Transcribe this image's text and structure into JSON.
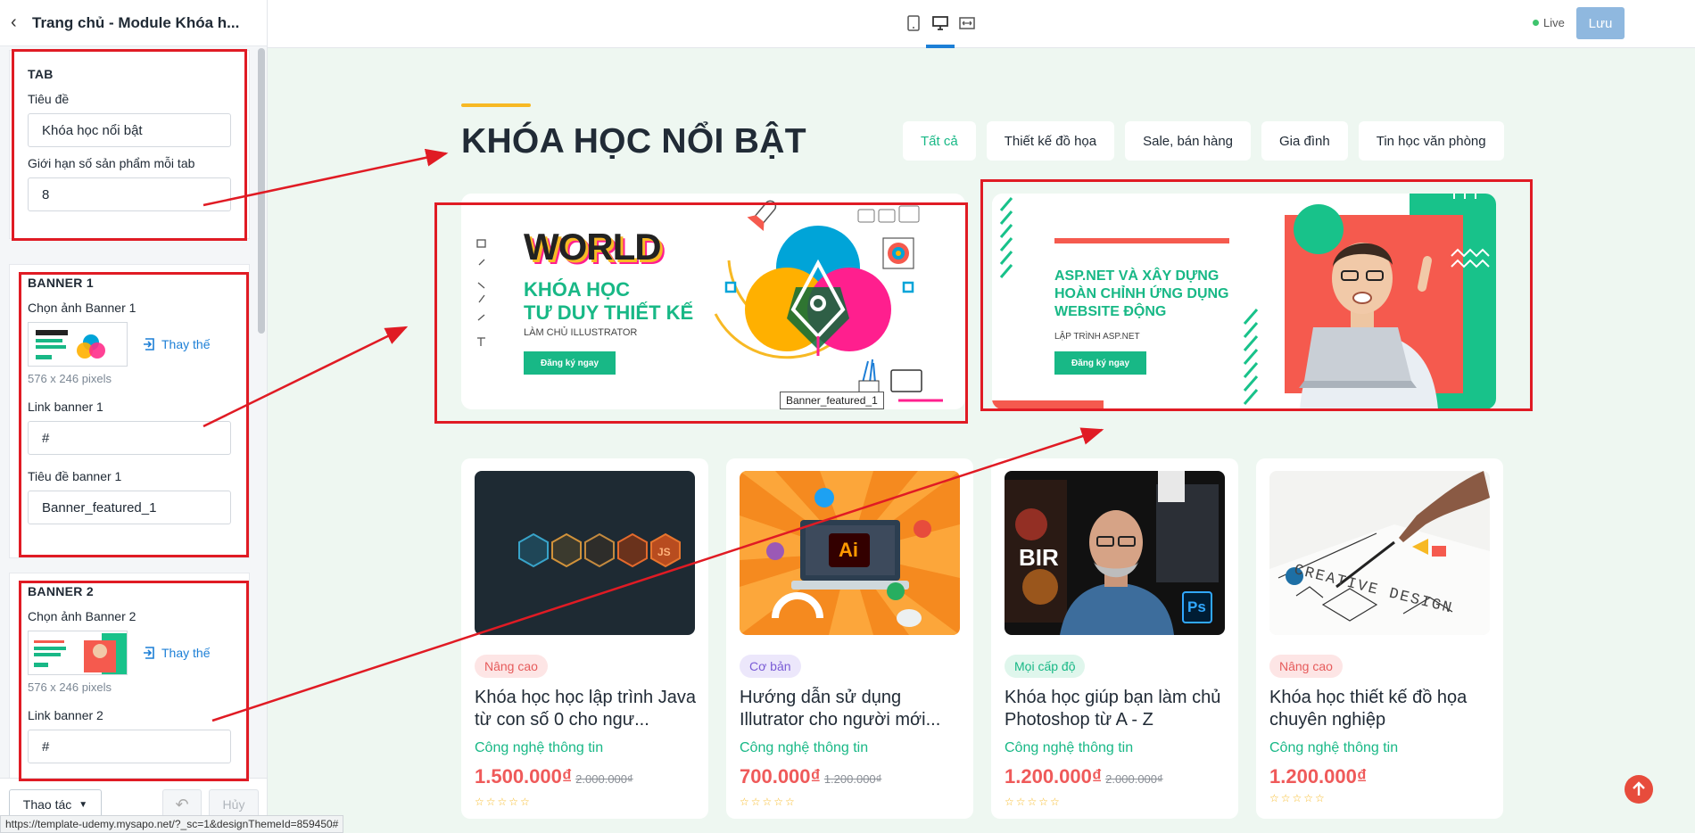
{
  "header": {
    "title": "Trang chủ - Module Khóa h...",
    "live_label": "Live",
    "save_label": "Lưu"
  },
  "tab_panel": {
    "heading": "TAB",
    "title_label": "Tiêu đề",
    "title_value": "Khóa học nổi bật",
    "limit_label": "Giới hạn số sản phẩm mỗi tab",
    "limit_value": "8"
  },
  "banner1_panel": {
    "heading": "BANNER 1",
    "image_label": "Chọn ảnh Banner 1",
    "replace_label": "Thay thế",
    "dims": "576 x 246 pixels",
    "link_label": "Link banner 1",
    "link_value": "#",
    "title_label": "Tiêu đề banner 1",
    "title_value": "Banner_featured_1"
  },
  "banner2_panel": {
    "heading": "BANNER 2",
    "image_label": "Chọn ảnh Banner 2",
    "replace_label": "Thay thế",
    "dims": "576 x 246 pixels",
    "link_label": "Link banner 2",
    "link_value": "#"
  },
  "footer": {
    "actions_label": "Thao tác",
    "cancel_label": "Hủy",
    "status_url": "https://template-udemy.mysapo.net/?_sc=1&designThemeId=859450#"
  },
  "section": {
    "title": "KHÓA HỌC NỔI BẬT",
    "tabs": [
      {
        "label": "Tất cả"
      },
      {
        "label": "Thiết kế đồ họa"
      },
      {
        "label": "Sale, bán hàng"
      },
      {
        "label": "Gia đình"
      },
      {
        "label": "Tin học văn phòng"
      }
    ]
  },
  "banner1": {
    "big": "WORLD",
    "line1": "KHÓA HỌC",
    "line2": "TƯ DUY THIẾT KẾ",
    "sub": "LÀM CHỦ ILLUSTRATOR",
    "cta": "Đăng ký ngay",
    "tooltip": "Banner_featured_1"
  },
  "banner2": {
    "line1": "ASP.NET VÀ XÂY DỰNG",
    "line2": "HOÀN CHỈNH ỨNG DỤNG",
    "line3": "WEBSITE ĐỘNG",
    "sub": "LẬP TRÌNH ASP.NET",
    "cta": "Đăng ký ngay"
  },
  "courses": [
    {
      "level": "Nâng cao",
      "title": "Khóa học học lập trình Java từ con số 0 cho ngư...",
      "category": "Công nghệ thông tin",
      "price": "1.500.000₫",
      "old_price": "2.000.000₫",
      "stars": "☆☆☆☆☆"
    },
    {
      "level": "Cơ bản",
      "title": "Hướng dẫn sử dụng Illutrator cho người mới...",
      "category": "Công nghệ thông tin",
      "price": "700.000₫",
      "old_price": "1.200.000₫",
      "stars": "☆☆☆☆☆"
    },
    {
      "level": "Mọi cấp độ",
      "title": "Khóa học giúp bạn làm chủ Photoshop từ A - Z",
      "category": "Công nghệ thông tin",
      "price": "1.200.000₫",
      "old_price": "2.000.000₫",
      "stars": "☆☆☆☆☆"
    },
    {
      "level": "Nâng cao",
      "title": "Khóa học thiết kế đồ họa chuyên nghiệp",
      "category": "Công nghệ thông tin",
      "price": "1.200.000₫",
      "old_price": "",
      "stars": "☆☆☆☆☆"
    }
  ],
  "images": {
    "card2_logo": "Ai",
    "card3_text": "BIR",
    "card3_ps": "Ps",
    "card4_text": "CREATIVE DESIGN"
  },
  "colors": {
    "accent_green": "#18b886",
    "price_red": "#ef5a5a",
    "annotation_red": "#e01b24",
    "save_blue": "#8fb8df"
  }
}
